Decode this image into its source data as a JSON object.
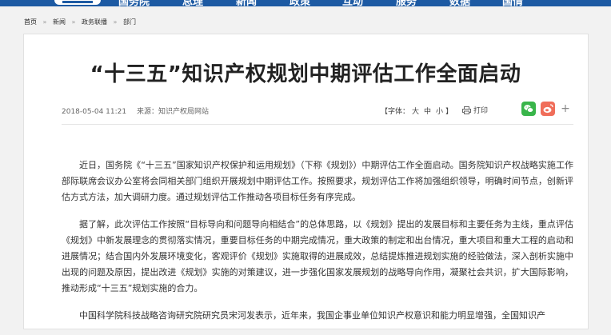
{
  "top_nav": {
    "items": [
      {
        "label": "国务院"
      },
      {
        "label": "总理"
      },
      {
        "label": "新闻"
      },
      {
        "label": "政策"
      },
      {
        "label": "互动"
      },
      {
        "label": "服务"
      },
      {
        "label": "数据"
      },
      {
        "label": "国情"
      }
    ]
  },
  "breadcrumb": {
    "items": [
      "首页",
      "新闻",
      "政务联播",
      "部门"
    ],
    "separator": "»"
  },
  "article": {
    "title": "“十三五”知识产权规划中期评估工作全面启动",
    "date": "2018-05-04 11:21",
    "source_label": "来源：",
    "source": "知识产权局网站",
    "font_size": {
      "label_open": "【字体：",
      "large": "大",
      "medium": "中",
      "small": "小",
      "label_close": "】"
    },
    "print_label": "打印",
    "paragraphs": [
      "近日，国务院《“十三五”国家知识产权保护和运用规划》（下称《规划》）中期评估工作全面启动。国务院知识产权战略实施工作部际联席会议办公室将会同相关部门组织开展规划中期评估工作。按照要求，规划评估工作将加强组织领导，明确时间节点，创新评估方式方法，加大调研力度。通过规划评估工作推动各项目标任务有序完成。",
      "据了解，此次评估工作按照“目标导向和问题导向相结合”的总体思路，以《规划》提出的发展目标和主要任务为主线，重点评估《规划》中新发展理念的贯彻落实情况，重要目标任务的中期完成情况，重大政策的制定和出台情况，重大项目和重大工程的启动和进展情况；结合国内外发展环境变化，客观评价《规划》实施取得的进展成效，总结提炼推进规划实施的经验做法，深入剖析实施中出现的问题及原因，提出改进《规划》实施的对策建议，进一步强化国家发展规划的战略导向作用，凝聚社会共识，扩大国际影响，推动形成“十三五”规划实施的合力。",
      "中国科学院科技战略咨询研究院研究员宋河发表示，近年来，我国企事业单位知识产权意识和能力明显增强，全国知识产"
    ]
  },
  "colors": {
    "nav_bg": "#1d5aa3",
    "wechat": "#39b54a",
    "weibo": "#f06e5a"
  },
  "icons": [
    "printer-icon",
    "wechat-share-icon",
    "weibo-share-icon",
    "plus-icon"
  ]
}
